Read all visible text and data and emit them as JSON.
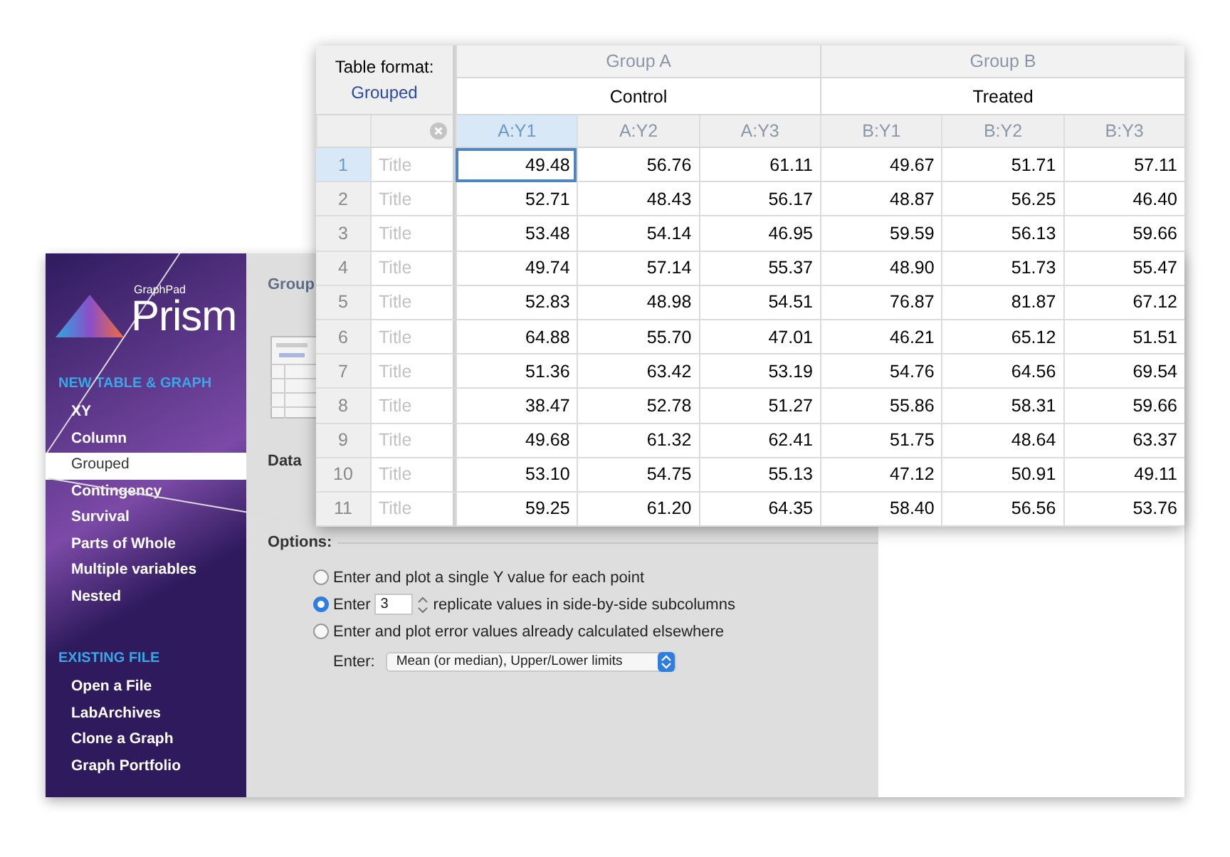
{
  "sidebar": {
    "logo_small": "GraphPad",
    "logo": "Prism",
    "sections": [
      {
        "heading": "NEW TABLE & GRAPH",
        "items": [
          {
            "label": "XY",
            "selected": false
          },
          {
            "label": "Column",
            "selected": false
          },
          {
            "label": "Grouped",
            "selected": true
          },
          {
            "label": "Contingency",
            "selected": false
          },
          {
            "label": "Survival",
            "selected": false
          },
          {
            "label": "Parts of Whole",
            "selected": false
          },
          {
            "label": "Multiple variables",
            "selected": false
          },
          {
            "label": "Nested",
            "selected": false
          }
        ]
      },
      {
        "heading": "EXISTING FILE",
        "items": [
          {
            "label": "Open a File",
            "selected": false
          },
          {
            "label": "LabArchives",
            "selected": false
          },
          {
            "label": "Clone a Graph",
            "selected": false
          },
          {
            "label": "Graph Portfolio",
            "selected": false
          }
        ]
      }
    ]
  },
  "main": {
    "heading": "Group",
    "data_label": "Data",
    "options_heading": "Options:",
    "options": [
      {
        "kind": "plain",
        "label": "Enter and plot a single Y value for each point",
        "selected": false
      },
      {
        "kind": "replicates",
        "before": "Enter",
        "value": "3",
        "after": "replicate values in side-by-side subcolumns",
        "selected": true
      },
      {
        "kind": "plain",
        "label": "Enter and plot error values already calculated elsewhere",
        "selected": false
      }
    ],
    "enter_label": "Enter:",
    "enter_dropdown": "Mean (or median), Upper/Lower limits"
  },
  "table": {
    "format_label": "Table format:",
    "format_value": "Grouped",
    "groups": [
      {
        "title": "Group A",
        "name": "Control"
      },
      {
        "title": "Group B",
        "name": "Treated"
      }
    ],
    "columns": [
      {
        "label": "A:Y1",
        "selected": true
      },
      {
        "label": "A:Y2",
        "selected": false
      },
      {
        "label": "A:Y3",
        "selected": false
      },
      {
        "label": "B:Y1",
        "selected": false
      },
      {
        "label": "B:Y2",
        "selected": false
      },
      {
        "label": "B:Y3",
        "selected": false
      }
    ],
    "rows": [
      {
        "number": "1",
        "title": "Title",
        "selected": true,
        "values": [
          "49.48",
          "56.76",
          "61.11",
          "49.67",
          "51.71",
          "57.11"
        ]
      },
      {
        "number": "2",
        "title": "Title",
        "selected": false,
        "values": [
          "52.71",
          "48.43",
          "56.17",
          "48.87",
          "56.25",
          "46.40"
        ]
      },
      {
        "number": "3",
        "title": "Title",
        "selected": false,
        "values": [
          "53.48",
          "54.14",
          "46.95",
          "59.59",
          "56.13",
          "59.66"
        ]
      },
      {
        "number": "4",
        "title": "Title",
        "selected": false,
        "values": [
          "49.74",
          "57.14",
          "55.37",
          "48.90",
          "51.73",
          "55.47"
        ]
      },
      {
        "number": "5",
        "title": "Title",
        "selected": false,
        "values": [
          "52.83",
          "48.98",
          "54.51",
          "76.87",
          "81.87",
          "67.12"
        ]
      },
      {
        "number": "6",
        "title": "Title",
        "selected": false,
        "values": [
          "64.88",
          "55.70",
          "47.01",
          "46.21",
          "65.12",
          "51.51"
        ]
      },
      {
        "number": "7",
        "title": "Title",
        "selected": false,
        "values": [
          "51.36",
          "63.42",
          "53.19",
          "54.76",
          "64.56",
          "69.54"
        ]
      },
      {
        "number": "8",
        "title": "Title",
        "selected": false,
        "values": [
          "38.47",
          "52.78",
          "51.27",
          "55.86",
          "58.31",
          "59.66"
        ]
      },
      {
        "number": "9",
        "title": "Title",
        "selected": false,
        "values": [
          "49.68",
          "61.32",
          "62.41",
          "51.75",
          "48.64",
          "63.37"
        ]
      },
      {
        "number": "10",
        "title": "Title",
        "selected": false,
        "values": [
          "53.10",
          "54.75",
          "55.13",
          "47.12",
          "50.91",
          "49.11"
        ]
      },
      {
        "number": "11",
        "title": "Title",
        "selected": false,
        "values": [
          "59.25",
          "61.20",
          "64.35",
          "58.40",
          "56.56",
          "53.76"
        ]
      }
    ]
  }
}
